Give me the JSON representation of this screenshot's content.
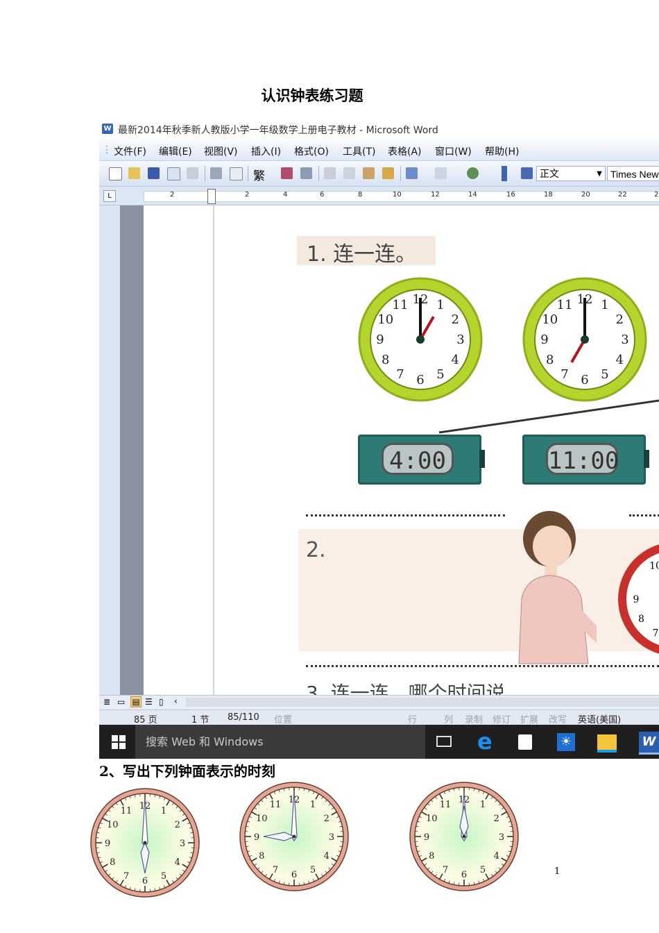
{
  "doc_title": "认识钟表练习题",
  "word": {
    "window_title": "最新2014年秋季新人教版小学一年级数学上册电子教材 - Microsoft Word",
    "menu": [
      "文件(F)",
      "编辑(E)",
      "视图(V)",
      "插入(I)",
      "格式(O)",
      "工具(T)",
      "表格(A)",
      "窗口(W)",
      "帮助(H)"
    ],
    "toolbar": {
      "trad_char": "繁",
      "style_value": "正文",
      "font_value": "Times New"
    },
    "ruler_numbers": [
      "2",
      "2",
      "4",
      "6",
      "8",
      "10",
      "12",
      "14",
      "16",
      "18",
      "20",
      "22",
      "2"
    ],
    "status": {
      "page": "85 页",
      "section": "1 节",
      "page_of": "85/110",
      "position": "位置",
      "line": "行",
      "column": "列",
      "rec": "录制",
      "trk": "修订",
      "ext": "扩展",
      "ovr": "改写",
      "language": "英语(美国)"
    },
    "taskbar": {
      "search_placeholder": "搜索 Web 和 Windows"
    },
    "textbook": {
      "section1_label": "1. 连一连。",
      "section2_label": "2.",
      "digital_times": [
        "4:00",
        "11:00"
      ],
      "analog_times": [
        "1:00",
        "7:00"
      ],
      "section3_partial": "3. 连一连，哪个时间说"
    }
  },
  "question2": {
    "title": "2、写出下列钟面表示的时刻",
    "clock_numbers": [
      "12",
      "1",
      "2",
      "3",
      "4",
      "5",
      "6",
      "7",
      "8",
      "9",
      "10",
      "11"
    ]
  },
  "page_number": "1",
  "colors": {
    "clock_rim": "#b5d42e",
    "clock_rim_dark": "#8fae1b",
    "face_rim": "#e3a796",
    "face_glow": "#c8f5c8",
    "lcd": "#2e7b76"
  }
}
